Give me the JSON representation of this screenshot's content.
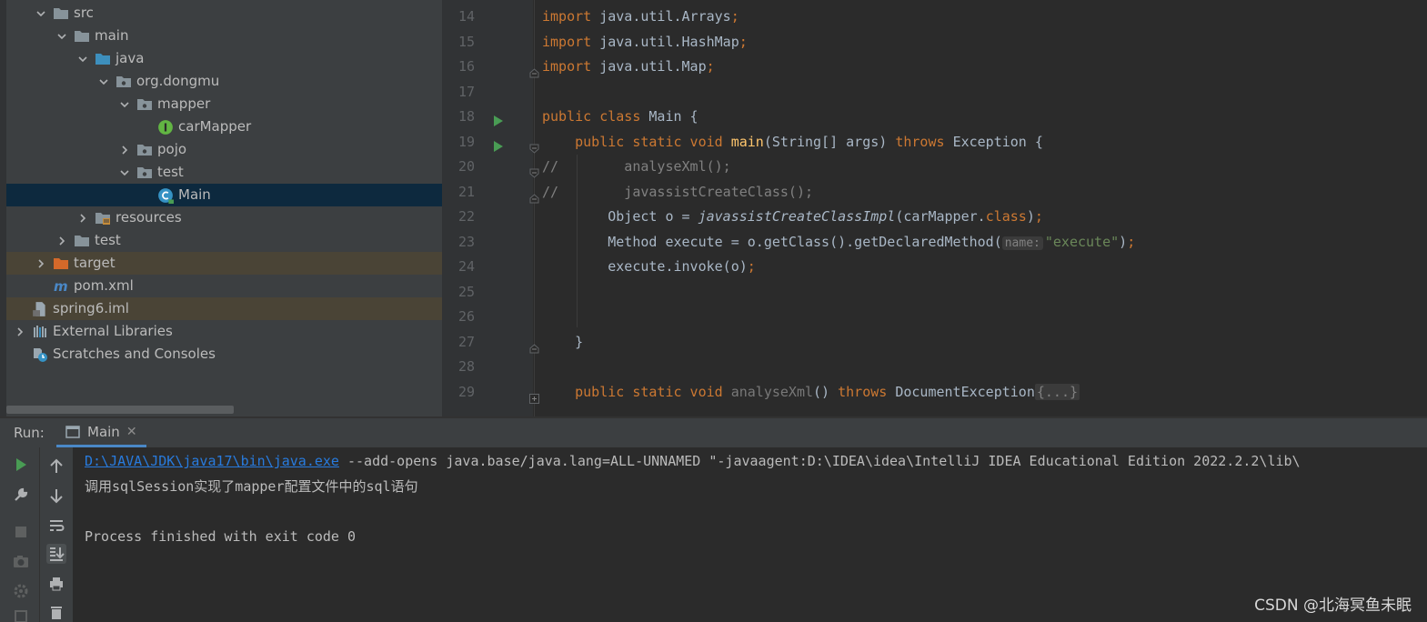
{
  "project_tree": {
    "items": [
      {
        "label": "src",
        "depth": 1,
        "expanded": true,
        "icon": "folder-icon"
      },
      {
        "label": "main",
        "depth": 2,
        "expanded": true,
        "icon": "folder-icon"
      },
      {
        "label": "java",
        "depth": 3,
        "expanded": true,
        "icon": "source-folder-icon"
      },
      {
        "label": "org.dongmu",
        "depth": 4,
        "expanded": true,
        "icon": "package-icon"
      },
      {
        "label": "mapper",
        "depth": 5,
        "expanded": true,
        "icon": "package-icon"
      },
      {
        "label": "carMapper",
        "depth": 6,
        "expanded": null,
        "icon": "interface-icon"
      },
      {
        "label": "pojo",
        "depth": 5,
        "expanded": false,
        "icon": "package-icon"
      },
      {
        "label": "test",
        "depth": 5,
        "expanded": true,
        "icon": "package-icon"
      },
      {
        "label": "Main",
        "depth": 6,
        "expanded": null,
        "icon": "class-icon",
        "selected": true
      },
      {
        "label": "resources",
        "depth": 3,
        "expanded": false,
        "icon": "resources-folder-icon"
      },
      {
        "label": "test",
        "depth": 2,
        "expanded": false,
        "icon": "folder-icon"
      },
      {
        "label": "target",
        "depth": 1,
        "expanded": false,
        "icon": "excluded-folder-icon",
        "excluded": true
      },
      {
        "label": "pom.xml",
        "depth": 1,
        "expanded": null,
        "icon": "maven-icon"
      },
      {
        "label": "spring6.iml",
        "depth": 0,
        "expanded": null,
        "icon": "iml-file-icon",
        "excluded": true
      },
      {
        "label": "External Libraries",
        "depth": 0,
        "expanded": false,
        "icon": "libraries-icon"
      },
      {
        "label": "Scratches and Consoles",
        "depth": 0,
        "expanded": null,
        "icon": "scratches-icon"
      }
    ]
  },
  "editor": {
    "lines": [
      {
        "num": "14",
        "code": [
          [
            "kw",
            "import "
          ],
          [
            "p",
            "java.util.Arrays"
          ],
          [
            "kw",
            ";"
          ]
        ]
      },
      {
        "num": "15",
        "code": [
          [
            "kw",
            "import "
          ],
          [
            "p",
            "java.util.HashMap"
          ],
          [
            "kw",
            ";"
          ]
        ]
      },
      {
        "num": "16",
        "code": [
          [
            "kw",
            "import "
          ],
          [
            "p",
            "java.util.Map"
          ],
          [
            "kw",
            ";"
          ]
        ]
      },
      {
        "num": "17",
        "code": []
      },
      {
        "num": "18",
        "code": [
          [
            "kw",
            "public class "
          ],
          [
            "p",
            "Main {"
          ]
        ]
      },
      {
        "num": "19",
        "code": [
          [
            "p",
            "    "
          ],
          [
            "kw",
            "public static void "
          ],
          [
            "fn",
            "main"
          ],
          [
            "p",
            "(String[] args) "
          ],
          [
            "kw",
            "throws "
          ],
          [
            "p",
            "Exception {"
          ]
        ]
      },
      {
        "num": "20",
        "code": [
          [
            "cmt",
            "//        analyseXml();"
          ]
        ]
      },
      {
        "num": "21",
        "code": [
          [
            "cmt",
            "//        javassistCreateClass();"
          ]
        ]
      },
      {
        "num": "22",
        "code": [
          [
            "p",
            "        Object o = "
          ],
          [
            "ital",
            "javassistCreateClassImpl"
          ],
          [
            "p",
            "(carMapper."
          ],
          [
            "kw",
            "class"
          ],
          [
            "p",
            ")"
          ],
          [
            "kw",
            ";"
          ]
        ]
      },
      {
        "num": "23",
        "code": [
          [
            "p",
            "        Method execute = o.getClass().getDeclaredMethod("
          ],
          [
            "hint",
            "name:"
          ],
          [
            "str",
            "\"execute\""
          ],
          [
            "p",
            ")"
          ],
          [
            "kw",
            ";"
          ]
        ]
      },
      {
        "num": "24",
        "code": [
          [
            "p",
            "        execute.invoke(o)"
          ],
          [
            "kw",
            ";"
          ]
        ]
      },
      {
        "num": "25",
        "code": []
      },
      {
        "num": "26",
        "code": []
      },
      {
        "num": "27",
        "code": [
          [
            "p",
            "    }"
          ]
        ]
      },
      {
        "num": "28",
        "code": []
      },
      {
        "num": "29",
        "code": [
          [
            "p",
            "    "
          ],
          [
            "kw",
            "public static void "
          ],
          [
            "gray",
            "analyseXml"
          ],
          [
            "p",
            "() "
          ],
          [
            "kw",
            "throws "
          ],
          [
            "p",
            "DocumentException"
          ],
          [
            "folded",
            "{...}"
          ]
        ]
      }
    ]
  },
  "run_panel": {
    "label": "Run:",
    "tab_label": "Main",
    "console_lines": [
      {
        "link": "D:\\JAVA\\JDK\\java17\\bin\\java.exe",
        "text": " --add-opens java.base/java.lang=ALL-UNNAMED \"-javaagent:D:\\IDEA\\idea\\IntelliJ IDEA Educational Edition 2022.2.2\\lib\\"
      },
      {
        "link": "",
        "text": "调用sqlSession实现了mapper配置文件中的sql语句"
      },
      {
        "link": "",
        "text": ""
      },
      {
        "link": "",
        "text": "Process finished with exit code 0"
      }
    ]
  },
  "watermark": "CSDN @北海冥鱼未眠",
  "colors": {
    "keyword": "#cc7832",
    "function": "#ffc66d",
    "string": "#6a8759",
    "comment": "#808080",
    "link": "#287bde",
    "selection": "#0d293e",
    "run_green": "#499c54"
  }
}
